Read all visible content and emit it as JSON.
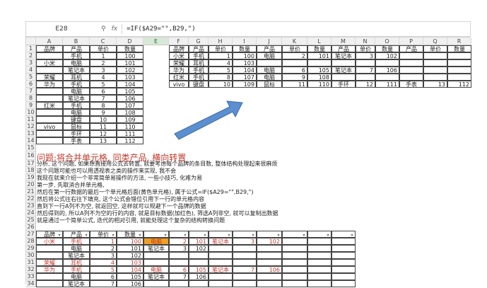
{
  "formula_bar": {
    "cell_ref": "E28",
    "icons": [
      "zoom-icon",
      "function-icon"
    ],
    "fx_label": "fx",
    "formula": "=IF($A29=\"\",B29,\")"
  },
  "columns": [
    "A",
    "B",
    "C",
    "D",
    "E",
    "F",
    "G",
    "H",
    "I",
    "J",
    "K",
    "L",
    "M",
    "N",
    "O",
    "P",
    "Q",
    "R"
  ],
  "selected_column": "E",
  "left_table": {
    "headers": [
      "品牌",
      "产品",
      "单价",
      "数量"
    ],
    "rows": [
      [
        "",
        "手机",
        "1",
        "100"
      ],
      [
        "小米",
        "电脑",
        "2",
        "101"
      ],
      [
        "",
        "笔记本",
        "3",
        "102"
      ],
      [
        "荣耀",
        "耳机",
        "4",
        "103"
      ],
      [
        "华为",
        "手机",
        "5",
        "104"
      ],
      [
        "",
        "电脑",
        "6",
        "105"
      ],
      [
        "",
        "笔记本",
        "7",
        "106"
      ],
      [
        "红米",
        "手机",
        "8",
        "107"
      ],
      [
        "",
        "电脑",
        "9",
        "108"
      ],
      [
        "",
        "键盘",
        "10",
        "109"
      ],
      [
        "vivo",
        "鼠标",
        "11",
        "110"
      ],
      [
        "",
        "手环",
        "12",
        "111"
      ],
      [
        "",
        "手表",
        "13",
        "112"
      ]
    ]
  },
  "right_table": {
    "headers": [
      "品牌",
      "产品",
      "单价",
      "数量",
      "产品",
      "单价",
      "数量",
      "产品",
      "单价",
      "数量",
      "产品",
      "单价",
      "数量"
    ],
    "rows": [
      [
        "小米",
        "手机",
        "1",
        "100",
        "电脑",
        "2",
        "101",
        "笔记本",
        "3",
        "102",
        "",
        "",
        ""
      ],
      [
        "荣耀",
        "耳机",
        "4",
        "103",
        "",
        "",
        "",
        "",
        "",
        "",
        "",
        "",
        ""
      ],
      [
        "华为",
        "手机",
        "5",
        "104",
        "电脑",
        "6",
        "105",
        "笔记本",
        "7",
        "106",
        "",
        "",
        ""
      ],
      [
        "红米",
        "手机",
        "8",
        "107",
        "电脑",
        "9",
        "108",
        "",
        "",
        "",
        "",
        "",
        ""
      ],
      [
        "vivo",
        "键盘",
        "10",
        "109",
        "鼠标",
        "11",
        "110",
        "手环",
        "12",
        "111",
        "手表",
        "13",
        "112"
      ]
    ]
  },
  "heading": "问题:将合并单元格, 同类产品, 横向转置",
  "notes": [
    "分析, 这个问题, 如果想直接用公式去转置, 就要考虑每个品牌的条目数, 整体结构处理起来很麻烦",
    "这个问题可能也可以用透视表之类的操作来实现, 我不会",
    "我现在就来介绍一个非常简单易操作的方法, 一些小技巧, 化难为易",
    "第一步, 先取消合并单元格,",
    "然后在第一行数据的最后一个单元格后面(黄色单元格), 属于公式=IF($A29=\"\",B29,\")",
    "然后将公式往右往下填充, 这个公式会错位引用下一行的单元格内容",
    "直到下一行A列不为空, 就返回空, 这样就可以规避下一个品牌的数据",
    "然后得到的, 所以A列不为空的行的内容, 就是目标数据(加红色), 筛选A列非空, 就可以复制出数据",
    "就是通过一个简单公式, 迭代的相对引用, 就能处理这个复杂的结构转换问题"
  ],
  "bottom_table": {
    "headers": [
      "品牌",
      "产品",
      "单价",
      "数量",
      "",
      "",
      "",
      "",
      "",
      "",
      "",
      "",
      ""
    ],
    "rows": [
      {
        "cells": [
          "小米",
          "手机",
          "1",
          "100",
          "电脑",
          "2",
          "101",
          "笔记本",
          "3",
          "102",
          "",
          "",
          ""
        ],
        "red": true,
        "highlight_e": true
      },
      {
        "cells": [
          "",
          "电脑",
          "2",
          "101",
          "笔记本",
          "3",
          "102",
          "",
          "",
          "",
          "",
          "",
          ""
        ],
        "red": false
      },
      {
        "cells": [
          "",
          "笔记本",
          "3",
          "102",
          "",
          "",
          "",
          "",
          "",
          "",
          "",
          "",
          ""
        ],
        "red": false
      },
      {
        "cells": [
          "荣耀",
          "耳机",
          "4",
          "103",
          "",
          "",
          "",
          "",
          "",
          "",
          "",
          "",
          ""
        ],
        "red": true
      },
      {
        "cells": [
          "华为",
          "手机",
          "5",
          "104",
          "电脑",
          "6",
          "105",
          "笔记本",
          "7",
          "106",
          "",
          "",
          ""
        ],
        "red": true
      },
      {
        "cells": [
          "",
          "电脑",
          "6",
          "105",
          "笔记本",
          "7",
          "106",
          "",
          "",
          "",
          "",
          "",
          ""
        ],
        "red": false
      },
      {
        "cells": [
          "",
          "笔记本",
          "7",
          "106",
          "",
          "",
          "",
          "",
          "",
          "",
          "",
          "",
          ""
        ],
        "red": false
      }
    ]
  },
  "row_numbers_top": [
    "1",
    "2",
    "3",
    "4",
    "5",
    "6",
    "7",
    "8",
    "9",
    "10",
    "11",
    "12",
    "13",
    "14",
    "15"
  ],
  "row_numbers_mid": [
    "16",
    "17",
    "18",
    "19",
    "20",
    "21",
    "22",
    "23",
    "24",
    "25",
    "26"
  ],
  "row_numbers_bottom": [
    "27",
    "28",
    "29",
    "30",
    "31",
    "32",
    "33",
    "34"
  ]
}
